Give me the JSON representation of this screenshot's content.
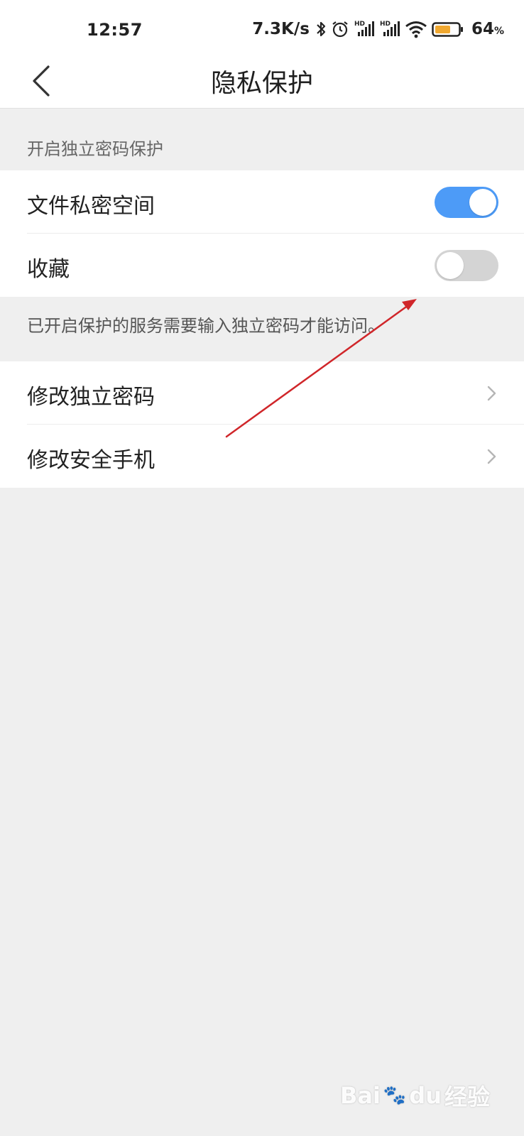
{
  "status_bar": {
    "time": "12:57",
    "net_speed": "7.3K/s",
    "battery_percent": "64",
    "battery_unit": "%",
    "icons": [
      "bluetooth-icon",
      "alarm-icon",
      "signal-hd-icon",
      "signal-hd-icon",
      "wifi-icon",
      "battery-icon"
    ],
    "battery_color": "#f0a830"
  },
  "header": {
    "title": "隐私保护"
  },
  "section_password": {
    "label": "开启独立密码保护",
    "items": [
      {
        "label": "文件私密空间",
        "toggle": "on"
      },
      {
        "label": "收藏",
        "toggle": "off"
      }
    ],
    "help": "已开启保护的服务需要输入独立密码才能访问。"
  },
  "section_manage": {
    "items": [
      {
        "label": "修改独立密码"
      },
      {
        "label": "修改安全手机"
      }
    ]
  },
  "watermark": {
    "brand": "Bai",
    "brand2": "du",
    "suffix": "经验"
  },
  "colors": {
    "toggle_on": "#4d9bf7",
    "toggle_off": "#d4d4d4",
    "annotation": "#d0262a"
  }
}
